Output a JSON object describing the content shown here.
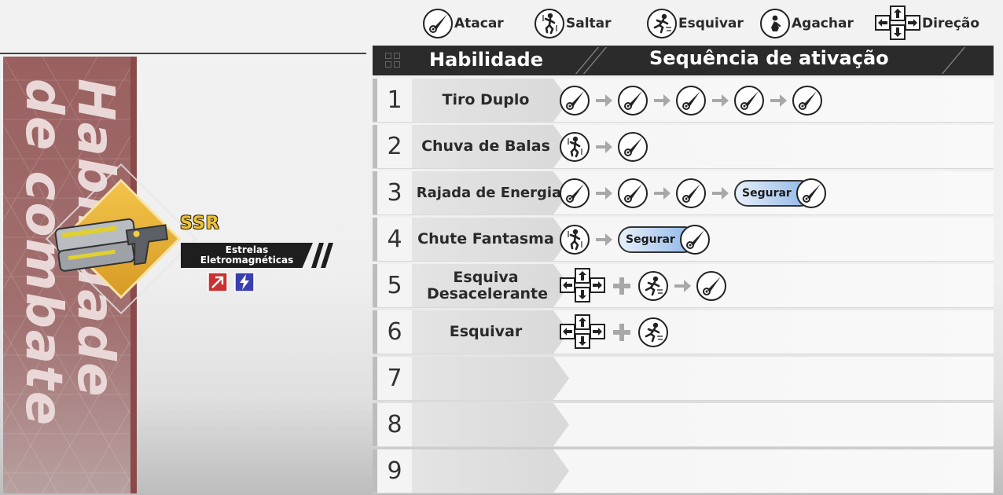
{
  "legend": {
    "attack": {
      "label": "Atacar",
      "icon": "attack-icon"
    },
    "jump": {
      "label": "Saltar",
      "icon": "jump-icon"
    },
    "dodge": {
      "label": "Esquivar",
      "icon": "dodge-icon"
    },
    "crouch": {
      "label": "Agachar",
      "icon": "crouch-icon"
    },
    "direction": {
      "label": "Direção",
      "icon": "direction-pad-icon"
    }
  },
  "table": {
    "header_skill": "Habilidade",
    "header_sequence": "Sequência de ativação",
    "rows": [
      {
        "num": "1",
        "name": "Tiro Duplo",
        "sequence": [
          "attack",
          "arrow",
          "attack",
          "arrow",
          "attack",
          "arrow",
          "attack",
          "arrow",
          "attack"
        ]
      },
      {
        "num": "2",
        "name": "Chuva de Balas",
        "sequence": [
          "jump",
          "arrow",
          "attack"
        ]
      },
      {
        "num": "3",
        "name": "Rajada de Energia",
        "sequence": [
          "attack",
          "arrow",
          "attack",
          "arrow",
          "attack",
          "arrow",
          "hold-attack"
        ]
      },
      {
        "num": "4",
        "name": "Chute Fantasma",
        "sequence": [
          "jump",
          "arrow",
          "hold-attack"
        ]
      },
      {
        "num": "5",
        "name": "Esquiva Desacelerante",
        "sequence": [
          "direction",
          "plus",
          "dodge",
          "arrow",
          "attack"
        ]
      },
      {
        "num": "6",
        "name": "Esquivar",
        "sequence": [
          "direction",
          "plus",
          "dodge"
        ]
      },
      {
        "num": "7",
        "name": "",
        "sequence": []
      },
      {
        "num": "8",
        "name": "",
        "sequence": []
      },
      {
        "num": "9",
        "name": "",
        "sequence": []
      }
    ],
    "hold_label": "Segurar"
  },
  "panel": {
    "title": "Habilidade\nde combate",
    "rarity": "SSR",
    "weapon_name_line1": "Estrelas",
    "weapon_name_line2": "Eletromagnéticas",
    "element_icons": [
      "physical-element-icon",
      "lightning-element-icon"
    ]
  },
  "colors": {
    "banner": "#9a6060",
    "diamond": "#f3c44a",
    "header_bg": "#2b2b2b",
    "hold_pill": "#8bb4e6",
    "rarity": "#e9c23b"
  }
}
